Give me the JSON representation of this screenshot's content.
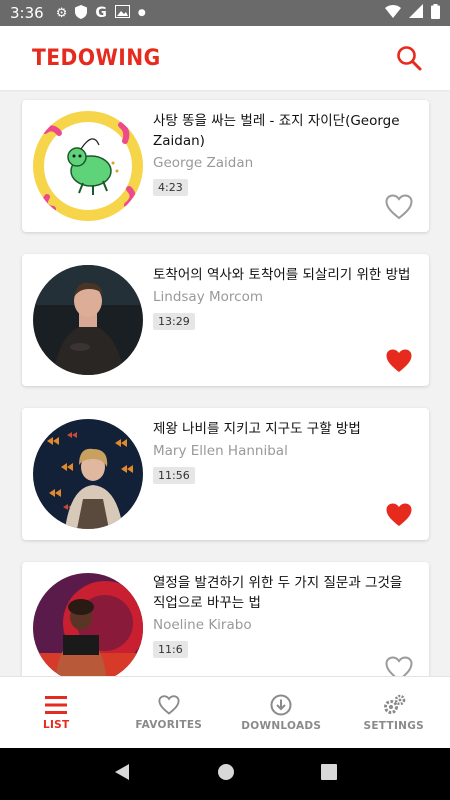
{
  "status_bar": {
    "time": "3:36"
  },
  "header": {
    "title": "TEDOWING"
  },
  "colors": {
    "accent": "#e62b1e",
    "muted": "#8a8a8a",
    "heart_off": "#9b9b9b"
  },
  "talks": [
    {
      "title": "사탕 똥을 싸는 벌레 - 죠지 자이단(George Zaidan)",
      "speaker": "George Zaidan",
      "duration": "4:23",
      "favorite": false
    },
    {
      "title": "토착어의 역사와 토착어를 되살리기 위한 방법",
      "speaker": "Lindsay Morcom",
      "duration": "13:29",
      "favorite": true
    },
    {
      "title": "제왕 나비를 지키고 지구도 구할 방법",
      "speaker": "Mary Ellen Hannibal",
      "duration": "11:56",
      "favorite": true
    },
    {
      "title": "열정을 발견하기 위한 두 가지 질문과 그것을 직업으로 바꾸는 법",
      "speaker": "Noeline Kirabo",
      "duration": "11:6",
      "favorite": false
    }
  ],
  "bottom_nav": {
    "list": "LIST",
    "favorites": "FAVORITES",
    "downloads": "DOWNLOADS",
    "settings": "SETTINGS"
  }
}
